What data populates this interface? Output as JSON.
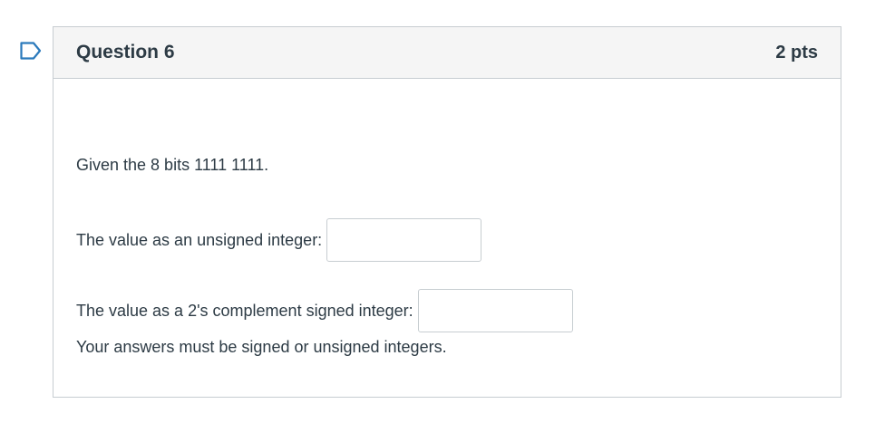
{
  "question": {
    "title": "Question 6",
    "points": "2 pts"
  },
  "body": {
    "prompt": "Given the 8 bits 1111 1111.",
    "unsigned_label": "The value as an unsigned integer:",
    "unsigned_value": "",
    "signed_label": "The value as a 2's complement signed integer:",
    "signed_value": "",
    "note": "Your answers must be signed or unsigned integers."
  },
  "colors": {
    "flag_outline": "#2b7abc",
    "border": "#c7cdd1",
    "header_bg": "#f5f5f5",
    "text": "#2d3b45"
  },
  "icons": {
    "flag": "bookmark-flag-icon"
  }
}
